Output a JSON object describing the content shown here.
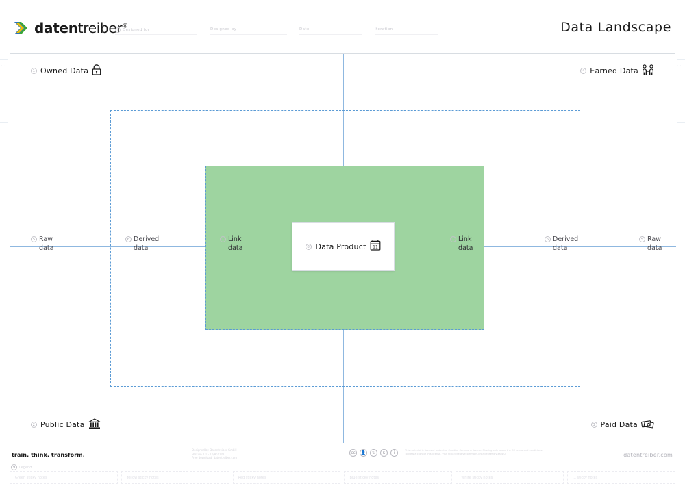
{
  "header": {
    "logo_text_bold": "daten",
    "logo_text_light": "treiber",
    "logo_registered": "®",
    "logo_icon": "chevron-logo-icon",
    "fields": [
      {
        "label": "Designed for",
        "badge": "i"
      },
      {
        "label": "Designed by",
        "badge": ""
      },
      {
        "label": "Date",
        "badge": ""
      },
      {
        "label": "Iteration",
        "badge": ""
      }
    ],
    "title": "Data Landscape"
  },
  "canvas": {
    "quadrants": [
      {
        "num": "1",
        "label": "Owned Data",
        "icon": "lock-icon"
      },
      {
        "num": "4",
        "label": "Earned Data",
        "icon": "handshake-people-icon"
      },
      {
        "num": "2",
        "label": "Public Data",
        "icon": "bank-building-icon"
      },
      {
        "num": "3",
        "label": "Paid Data",
        "icon": "banknotes-icon"
      }
    ],
    "axis_labels": [
      {
        "num": "5",
        "label": "Raw",
        "sub": "data"
      },
      {
        "num": "6",
        "label": "Derived",
        "sub": "data"
      },
      {
        "num": "7",
        "label": "Link",
        "sub": "data"
      },
      {
        "num": "7",
        "label": "Link",
        "sub": "data"
      },
      {
        "num": "6",
        "label": "Derived",
        "sub": "data"
      },
      {
        "num": "5",
        "label": "Raw",
        "sub": "data"
      }
    ],
    "product": {
      "num": "8",
      "label": "Data Product",
      "icon": "package-calendar-icon"
    },
    "colors": {
      "green_zone": "#9ed4a0",
      "axis_blue": "#8fb8e0",
      "dashed_blue": "#5b9bd5",
      "border_grey": "#d8dde2"
    }
  },
  "footer": {
    "tagline": "train. think. transform.",
    "imprint": "Designed by Datentreiber GmbH\nVersion 1.1 - 10/8/2019\nFree download: datentreiber.com",
    "cc_badges": [
      "cc-icon",
      "by-icon",
      "sa-icon",
      "nc-icon",
      "info-icon"
    ],
    "cc_text": "This material is licensed under the Creative Commons license. Sharing only under the CC terms and conditions.\nTo view a copy of this license, visit http://creativecommons.org/licenses/by-sa/4.0/",
    "website": "datentreiber.com"
  },
  "legend": {
    "title": "Legend",
    "badge": "9",
    "items": [
      "Green sticky notes",
      "Yellow sticky notes",
      "Red sticky notes",
      "Blue sticky notes",
      "White sticky notes",
      "... sticky notes"
    ]
  }
}
